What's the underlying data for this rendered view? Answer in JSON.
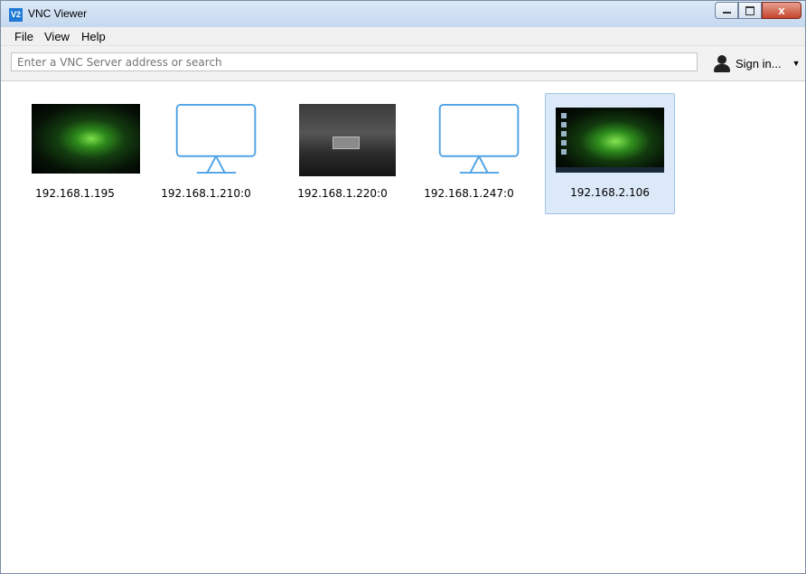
{
  "window": {
    "title": "VNC Viewer",
    "logo_text": "V2",
    "buttons": {
      "close": "x"
    }
  },
  "menu": [
    {
      "label": "File"
    },
    {
      "label": "View"
    },
    {
      "label": "Help"
    }
  ],
  "toolbar": {
    "search_placeholder": "Enter a VNC Server address or search",
    "search_value": "",
    "signin_label": "Sign in...",
    "signin_caret": "▼"
  },
  "connections": [
    {
      "address": "192.168.1.195",
      "thumbnail": "desktop-preview-green"
    },
    {
      "address": "192.168.1.210:0",
      "thumbnail": "monitor-icon"
    },
    {
      "address": "192.168.1.220:0",
      "thumbnail": "desktop-preview-dark"
    },
    {
      "address": "192.168.1.247:0",
      "thumbnail": "monitor-icon"
    },
    {
      "address": "192.168.2.106",
      "thumbnail": "desktop-preview-green",
      "selected": true
    }
  ],
  "colors": {
    "accent": "#1f7ad6",
    "monitor_stroke": "#4fa3e6",
    "selection_fill": "#dce9f8",
    "selection_border": "#9fc2e8"
  }
}
